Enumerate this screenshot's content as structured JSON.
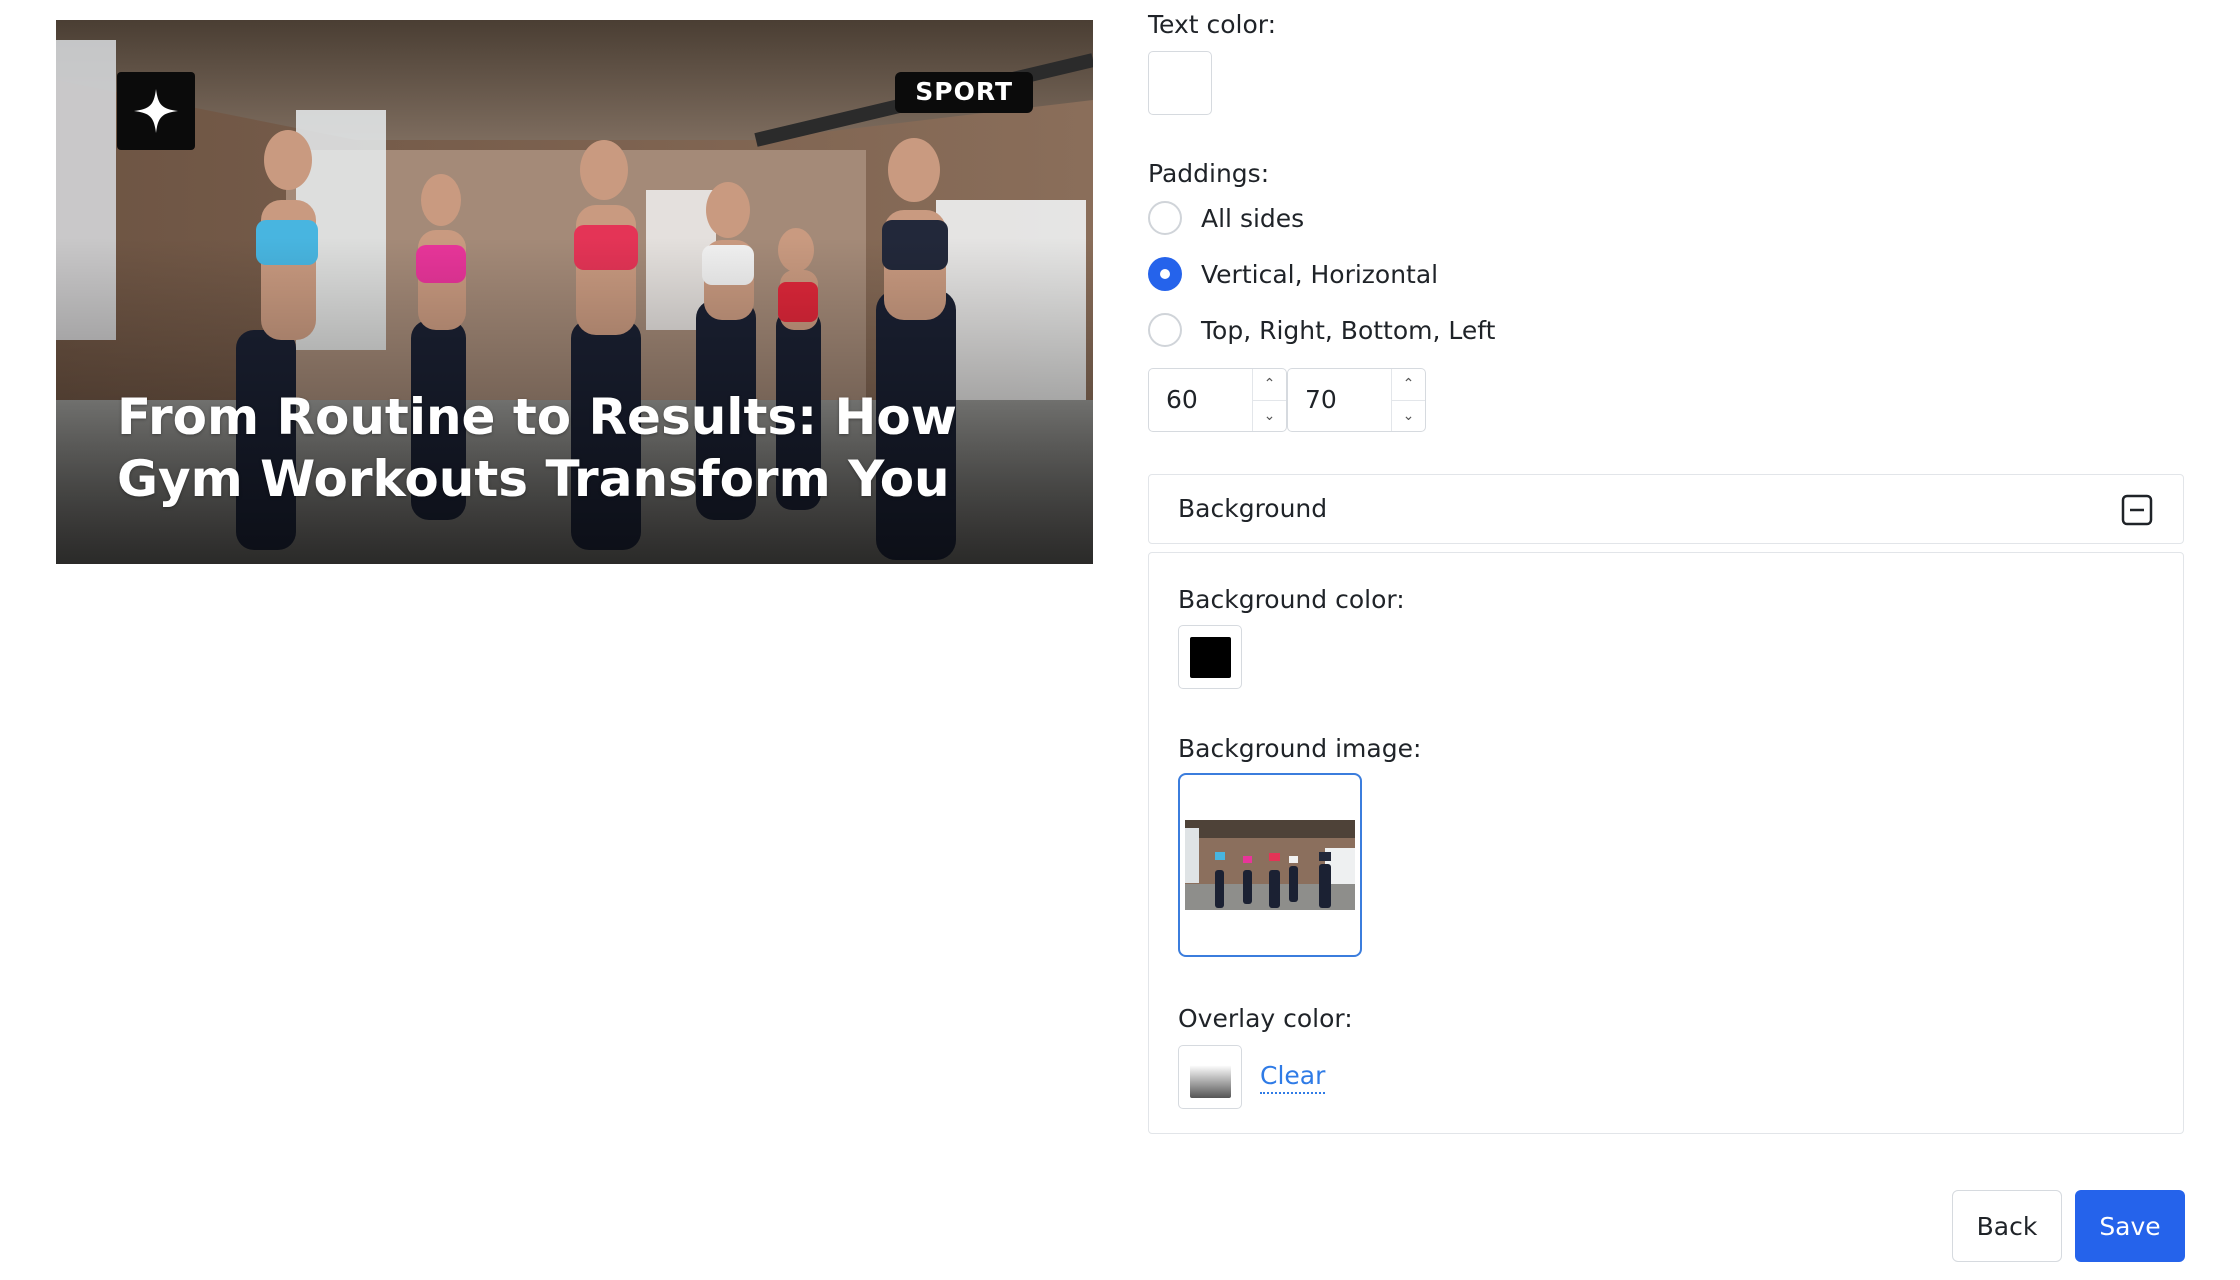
{
  "preview": {
    "tag": "SPORT",
    "headline": "From Routine to Results: How Gym Workouts Transform You",
    "logo_icon": "sparkle-icon"
  },
  "settings": {
    "text_color_label": "Text color:",
    "text_color_value": "#ffffff",
    "paddings_label": "Paddings:",
    "padding_options": [
      {
        "label": "All sides",
        "checked": false
      },
      {
        "label": "Vertical, Horizontal",
        "checked": true
      },
      {
        "label": "Top, Right, Bottom, Left",
        "checked": false
      }
    ],
    "padding_vertical": "60",
    "padding_horizontal": "70",
    "background_section": {
      "title": "Background",
      "toggle_icon": "collapse-minus-icon",
      "bg_color_label": "Background color:",
      "bg_color_value": "#000000",
      "bg_image_label": "Background image:",
      "overlay_color_label": "Overlay color:",
      "clear_label": "Clear"
    }
  },
  "actions": {
    "back_label": "Back",
    "save_label": "Save"
  },
  "colors": {
    "accent": "#2563eb",
    "link": "#2f7be6"
  }
}
